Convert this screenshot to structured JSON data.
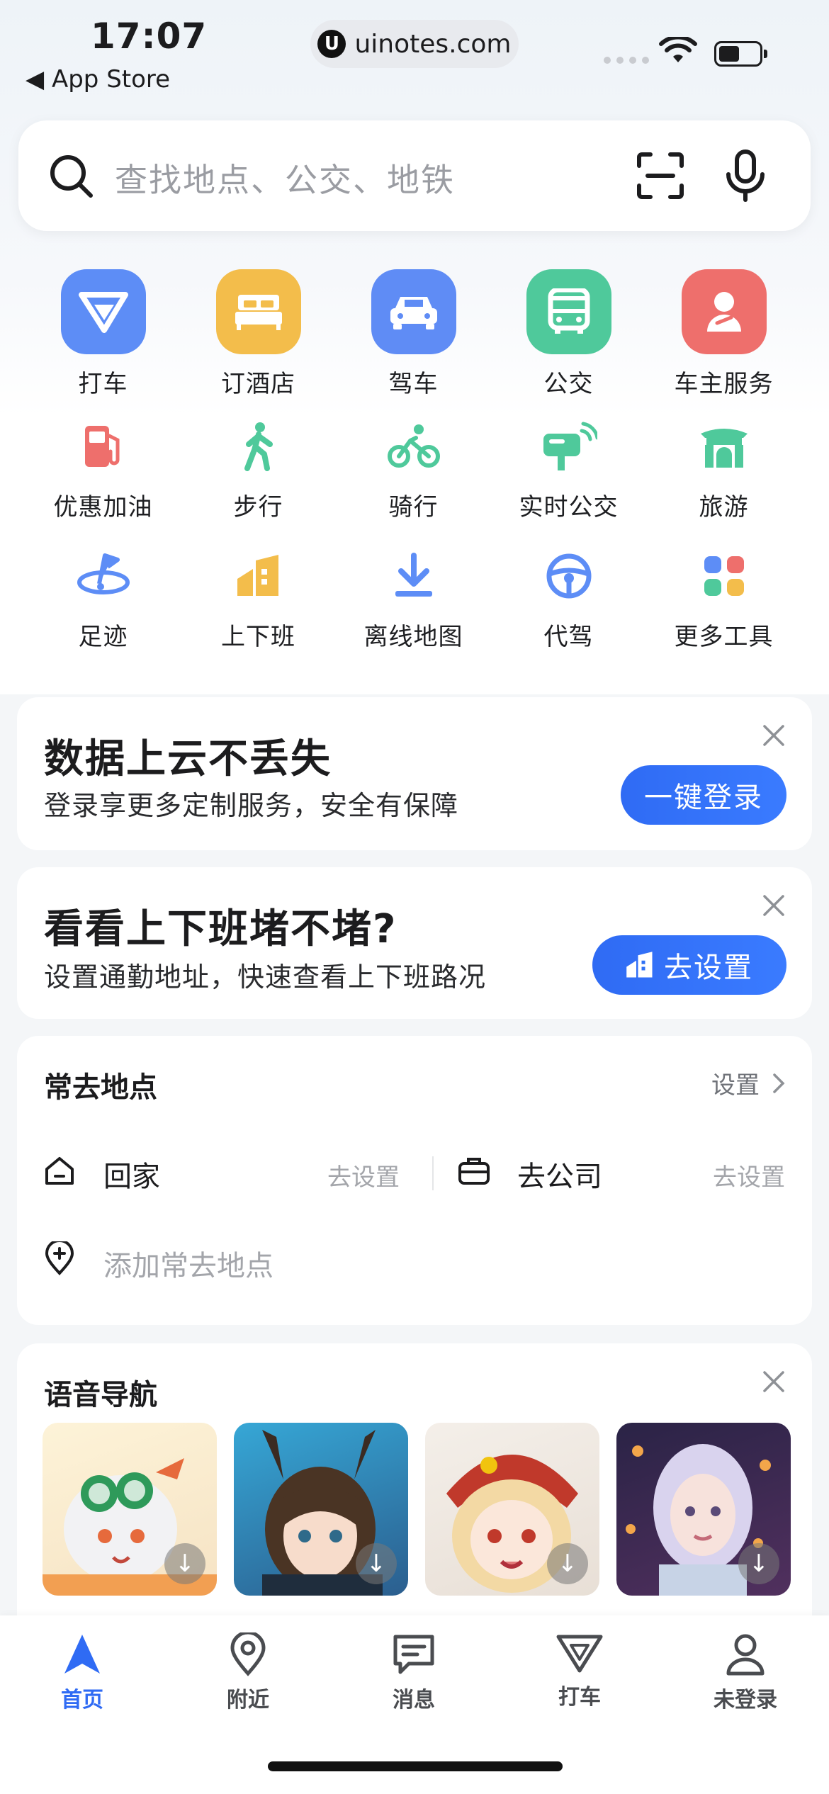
{
  "status_bar": {
    "time": "17:07",
    "back_app": "App Store",
    "url": "uinotes.com",
    "url_logo": "U"
  },
  "search": {
    "placeholder": "查找地点、公交、地铁"
  },
  "quick_actions": {
    "row1": [
      {
        "label": "打车",
        "icon": "taxi-icon",
        "color": "#5d8df6"
      },
      {
        "label": "订酒店",
        "icon": "hotel-bed-icon",
        "color": "#f3bd4b"
      },
      {
        "label": "驾车",
        "icon": "car-icon",
        "color": "#5f8cf5"
      },
      {
        "label": "公交",
        "icon": "bus-icon",
        "color": "#4fc99b"
      },
      {
        "label": "车主服务",
        "icon": "car-owner-icon",
        "color": "#ee6f6c"
      }
    ],
    "row2": [
      {
        "label": "优惠加油",
        "icon": "fuel-pump-icon"
      },
      {
        "label": "步行",
        "icon": "walking-icon"
      },
      {
        "label": "骑行",
        "icon": "cycling-icon"
      },
      {
        "label": "实时公交",
        "icon": "realtime-bus-icon"
      },
      {
        "label": "旅游",
        "icon": "travel-gate-icon"
      }
    ],
    "row3": [
      {
        "label": "足迹",
        "icon": "footprint-flag-icon"
      },
      {
        "label": "上下班",
        "icon": "commute-building-icon"
      },
      {
        "label": "离线地图",
        "icon": "download-icon"
      },
      {
        "label": "代驾",
        "icon": "steering-wheel-icon"
      },
      {
        "label": "更多工具",
        "icon": "more-tools-icon"
      }
    ]
  },
  "cloud_card": {
    "title": "数据上云不丢失",
    "subtitle": "登录享更多定制服务，安全有保障",
    "button": "一键登录"
  },
  "commute_card": {
    "title": "看看上下班堵不堵?",
    "subtitle": "设置通勤地址，快速查看上下班路况",
    "button": "去设置"
  },
  "frequent_places": {
    "title": "常去地点",
    "settings": "设置",
    "home": {
      "label": "回家",
      "action": "去设置"
    },
    "work": {
      "label": "去公司",
      "action": "去设置"
    },
    "add": "添加常去地点"
  },
  "voice_nav": {
    "title": "语音导航"
  },
  "tabbar": [
    {
      "label": "首页",
      "icon": "navigation-arrow-icon",
      "active": true
    },
    {
      "label": "附近",
      "icon": "location-pin-icon",
      "active": false
    },
    {
      "label": "消息",
      "icon": "message-icon",
      "active": false
    },
    {
      "label": "打车",
      "icon": "taxi-icon",
      "active": false
    },
    {
      "label": "未登录",
      "icon": "user-icon",
      "active": false
    }
  ],
  "colors": {
    "accent": "#2f6bf4",
    "green": "#4fc99b",
    "red": "#ee6f6c",
    "blue": "#5d8df6"
  }
}
